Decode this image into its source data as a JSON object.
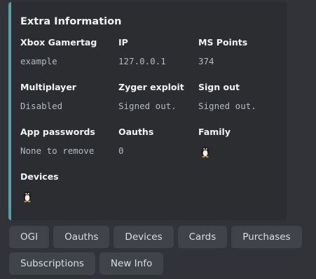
{
  "embed": {
    "title": "Extra Information",
    "accent_color": "#4fa3a6",
    "fields": {
      "xbox_gamertag": {
        "name": "Xbox Gamertag",
        "value": "example"
      },
      "ip": {
        "name": "IP",
        "value": "127.0.0.1"
      },
      "ms_points": {
        "name": "MS Points",
        "value": "374"
      },
      "multiplayer": {
        "name": "Multiplayer",
        "value": "Disabled"
      },
      "zyger_exploit": {
        "name": "Zyger exploit",
        "value": "Signed out."
      },
      "sign_out": {
        "name": "Sign out",
        "value": "Signed out."
      },
      "app_passwords": {
        "name": "App passwords",
        "value": "None to remove"
      },
      "oauths": {
        "name": "Oauths",
        "value": "0"
      },
      "family": {
        "name": "Family",
        "value_icon": "penguin-emoji"
      },
      "devices": {
        "name": "Devices",
        "value_icon": "penguin-emoji"
      }
    }
  },
  "buttons": {
    "row1": [
      "OGI",
      "Oauths",
      "Devices",
      "Cards",
      "Purchases"
    ],
    "row2": [
      "Subscriptions",
      "New Info"
    ]
  }
}
